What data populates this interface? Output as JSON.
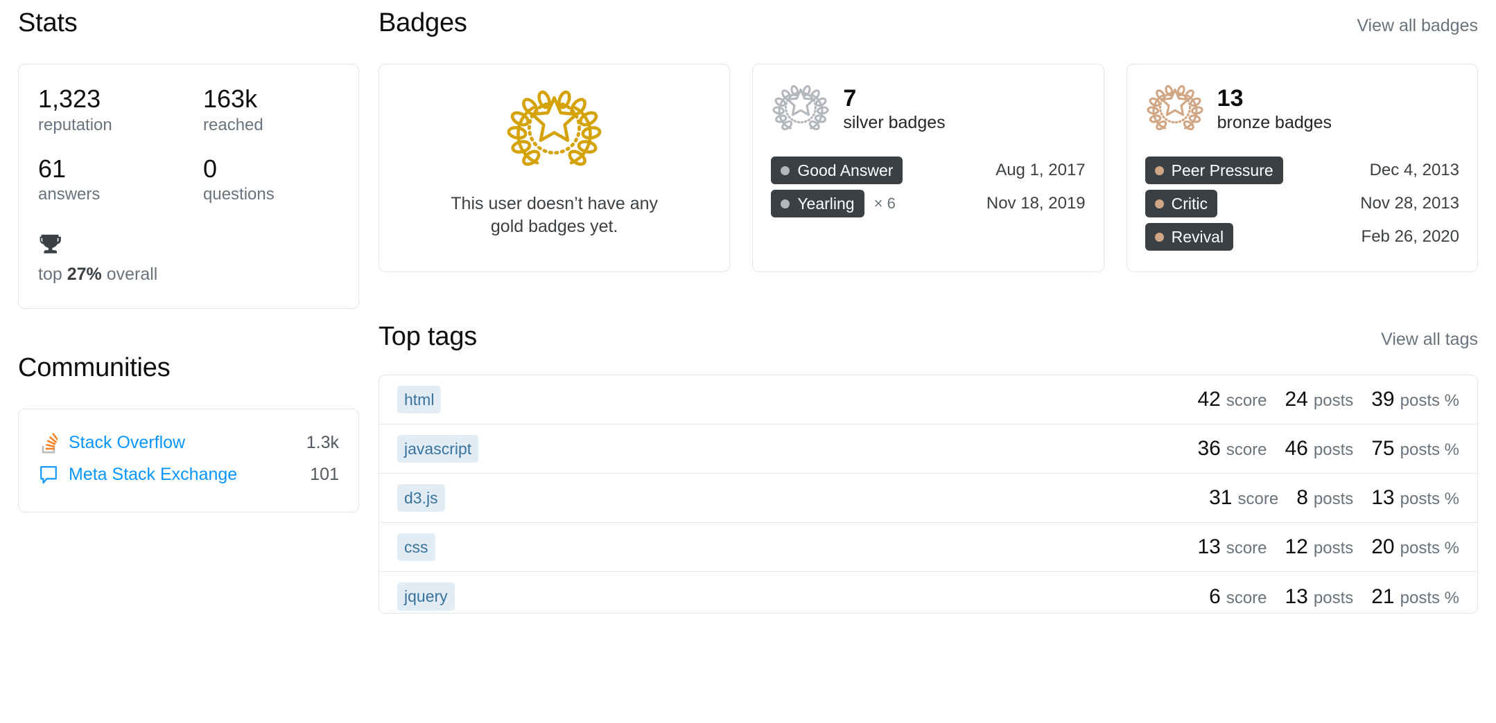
{
  "stats": {
    "title": "Stats",
    "items": [
      {
        "value": "1,323",
        "label": "reputation"
      },
      {
        "value": "163k",
        "label": "reached"
      },
      {
        "value": "61",
        "label": "answers"
      },
      {
        "value": "0",
        "label": "questions"
      }
    ],
    "top_percent": {
      "prefix": "top ",
      "value": "27%",
      "suffix": " overall",
      "icon": "trophy-icon"
    }
  },
  "communities": {
    "title": "Communities",
    "items": [
      {
        "name": "Stack Overflow",
        "rep": "1.3k",
        "icon": "stack-overflow-icon"
      },
      {
        "name": "Meta Stack Exchange",
        "rep": "101",
        "icon": "speech-bubble-icon"
      }
    ]
  },
  "badges": {
    "title": "Badges",
    "view_all": "View all badges",
    "gold": {
      "empty_message": "This user doesn’t have any gold badges yet.",
      "icon": "gold-laurel-badge-icon",
      "color": "#d4a309"
    },
    "silver": {
      "count": "7",
      "kind": "silver badges",
      "icon": "silver-laurel-badge-icon",
      "color": "#b4b8bc",
      "items": [
        {
          "name": "Good Answer",
          "multiplier": "",
          "date": "Aug 1, 2017"
        },
        {
          "name": "Yearling",
          "multiplier": "× 6",
          "date": "Nov 18, 2019"
        }
      ]
    },
    "bronze": {
      "count": "13",
      "kind": "bronze badges",
      "icon": "bronze-laurel-badge-icon",
      "color": "#d1a684",
      "items": [
        {
          "name": "Peer Pressure",
          "multiplier": "",
          "date": "Dec 4, 2013"
        },
        {
          "name": "Critic",
          "multiplier": "",
          "date": "Nov 28, 2013"
        },
        {
          "name": "Revival",
          "multiplier": "",
          "date": "Feb 26, 2020"
        }
      ]
    }
  },
  "top_tags": {
    "title": "Top tags",
    "view_all": "View all tags",
    "labels": {
      "score": "score",
      "posts": "posts",
      "posts_pct": "posts %"
    },
    "rows": [
      {
        "tag": "html",
        "score": "42",
        "posts": "24",
        "posts_pct": "39"
      },
      {
        "tag": "javascript",
        "score": "36",
        "posts": "46",
        "posts_pct": "75"
      },
      {
        "tag": "d3.js",
        "score": "31",
        "posts": "8",
        "posts_pct": "13"
      },
      {
        "tag": "css",
        "score": "13",
        "posts": "12",
        "posts_pct": "20"
      },
      {
        "tag": "jquery",
        "score": "6",
        "posts": "13",
        "posts_pct": "21"
      }
    ]
  }
}
